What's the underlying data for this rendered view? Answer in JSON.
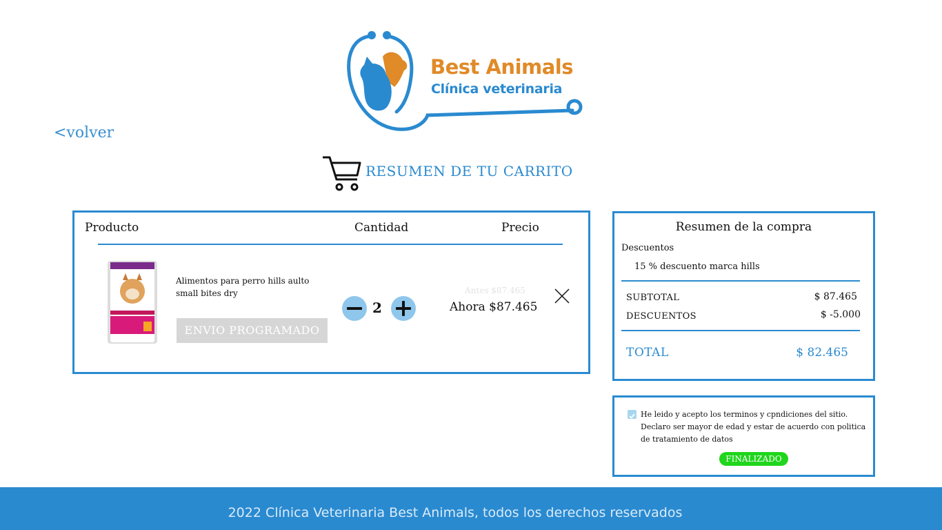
{
  "brand": {
    "name_line1": "Best Animals",
    "name_line2": "Clínica veterinaria",
    "colors": {
      "orange": "#e08a28",
      "blue": "#2a8ad0"
    }
  },
  "nav": {
    "back_label": "<volver"
  },
  "cart": {
    "title": "RESUMEN DE TU CARRITO",
    "icon": "shopping-cart-icon"
  },
  "product_table": {
    "headers": {
      "product": "Producto",
      "quantity": "Cantidad",
      "price": "Precio"
    },
    "item": {
      "name": "Alimentos para perro hills aulto small bites dry",
      "shipping_button": "ENVIO PROGRAMADO",
      "quantity": "2",
      "price_before": "Antes $87.465",
      "price_now": "Ahora $87.465",
      "remove_icon": "close-icon",
      "minus_icon": "minus-icon",
      "plus_icon": "plus-icon"
    }
  },
  "summary": {
    "title": "Resumen de la compra",
    "discounts_label": "Descuentos",
    "discount_item": "15 % descuento marca hills",
    "subtotal_label": "SUBTOTAL",
    "subtotal_value": "$ 87.465",
    "discounts_total_label": "DESCUENTOS",
    "discounts_total_value": "$ -5.000",
    "total_label": "TOTAL",
    "total_value": "$ 82.465"
  },
  "terms": {
    "checked": true,
    "text": "He leido y acepto los terminos y cpndiciones del sitio. Declaro ser mayor de edad y estar de acuerdo con politica de tratamiento de datos",
    "finalize_label": "FINALIZADO",
    "finalize_color": "#1fd61c"
  },
  "footer": {
    "text": "2022 Clínica Veterinaria Best Animals, todos los derechos reservados"
  }
}
